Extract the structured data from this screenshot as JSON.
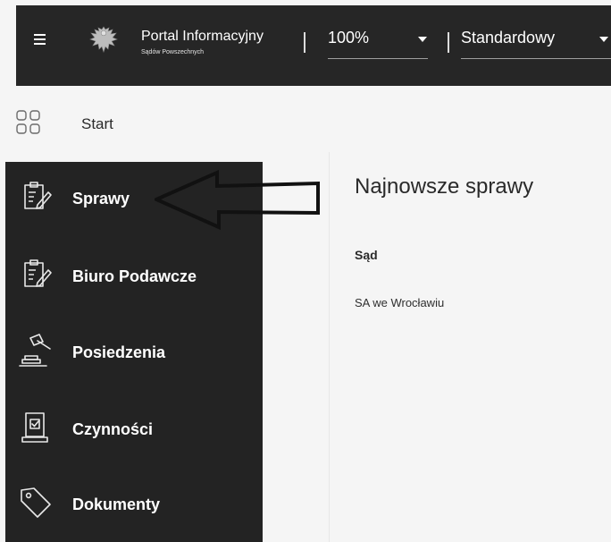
{
  "header": {
    "menu_icon": "hamburger-menu-icon",
    "logo_icon": "eagle-emblem-icon",
    "title": "Portal Informacyjny",
    "subtitle": "Sądów Powszechnych",
    "zoom": {
      "value": "100%",
      "icon": "chevron-down-icon"
    },
    "contrast": {
      "value": "Standardowy",
      "icon": "chevron-down-icon"
    }
  },
  "start": {
    "label": "Start",
    "icon": "grid-icon"
  },
  "sidebar": {
    "items": [
      {
        "label": "Sprawy",
        "icon": "clipboard-pen-icon"
      },
      {
        "label": "Biuro Podawcze",
        "icon": "clipboard-pen-icon"
      },
      {
        "label": "Posiedzenia",
        "icon": "gavel-icon"
      },
      {
        "label": "Czynności",
        "icon": "checked-document-icon"
      },
      {
        "label": "Dokumenty",
        "icon": "tag-icon"
      }
    ]
  },
  "annotation": {
    "icon": "outline-arrow-left-icon"
  },
  "main": {
    "title": "Najnowsze sprawy",
    "table": {
      "columns": [
        "Sąd"
      ],
      "rows": [
        [
          "SA we Wrocławiu"
        ]
      ]
    }
  },
  "colors": {
    "topbar": "#262626",
    "sidebar": "#232323",
    "background": "#f5f5f5",
    "text_dark": "#2a2a2a",
    "text_light": "#ffffff"
  }
}
